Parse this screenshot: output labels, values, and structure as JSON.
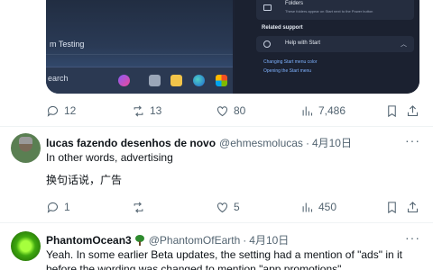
{
  "media": {
    "teams_label": "m Testing",
    "search_label": "earch",
    "folders_title": "Folders",
    "folders_desc": "These folders appear on Start next to the Power button",
    "related_title": "Related support",
    "help_label": "Help with Start",
    "link1": "Changing Start menu color",
    "link2": "Opening the Start menu"
  },
  "tweet0": {
    "replies": "12",
    "retweets": "13",
    "likes": "80",
    "views": "7,486"
  },
  "tweet1": {
    "name": "lucas fazendo desenhos de novo",
    "handle": "@ehmesmolucas",
    "time": "4月10日",
    "text_line1": "In other words, advertising",
    "text_line2": "换句话说，广告",
    "replies": "1",
    "retweets": "",
    "likes": "5",
    "views": "450"
  },
  "tweet2": {
    "name": "PhantomOcean3",
    "handle": "@PhantomOfEarth",
    "time": "4月10日",
    "text_line1": "Yeah. In some earlier Beta updates, the setting had a mention of \"ads\" in it",
    "text_line2": "before the wording was changed to mention \"app promotions\"."
  },
  "icons": [
    "reply-icon",
    "retweet-icon",
    "like-icon",
    "views-icon",
    "bookmark-icon",
    "share-icon",
    "more-icon",
    "tree-emoji-icon"
  ]
}
